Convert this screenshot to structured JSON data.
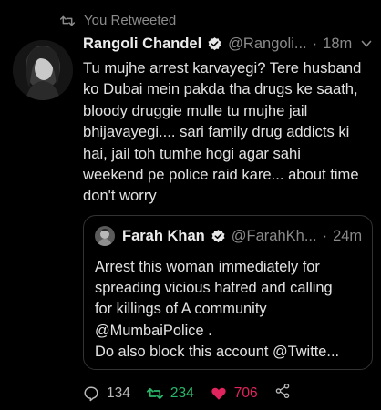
{
  "retweet_banner": "You Retweeted",
  "tweet": {
    "author_name": "Rangoli Chandel",
    "author_handle": "@Rangoli...",
    "time": "18m",
    "separator": "·",
    "text": "Tu mujhe arrest karvayegi? Tere husband\nko Dubai mein pakda tha drugs ke saath,\nbloody druggie mulle tu mujhe jail\nbhijavayegi.... sari family drug addicts ki\nhai, jail toh tumhe hogi agar sahi\nweekend pe police raid kare... about time\ndon't worry"
  },
  "quoted_tweet": {
    "author_name": "Farah Khan",
    "author_handle": "@FarahKh...",
    "time": "24m",
    "separator": "·",
    "text": "Arrest this woman immediately for\nspreading vicious hatred and calling\nfor killings of A community\n@MumbaiPolice .\nDo also block this account @Twitte..."
  },
  "actions": {
    "reply_count": "134",
    "retweet_count": "234",
    "like_count": "706"
  },
  "icons": {
    "retweet": "retweet-icon",
    "verified": "verified-badge-icon",
    "caret": "chevron-down-icon",
    "reply": "reply-icon",
    "like": "heart-icon",
    "share": "share-icon"
  },
  "colors": {
    "background": "#000000",
    "retweet_active": "#29b66a",
    "like_active": "#e0245e",
    "muted": "#8a8a8a"
  }
}
